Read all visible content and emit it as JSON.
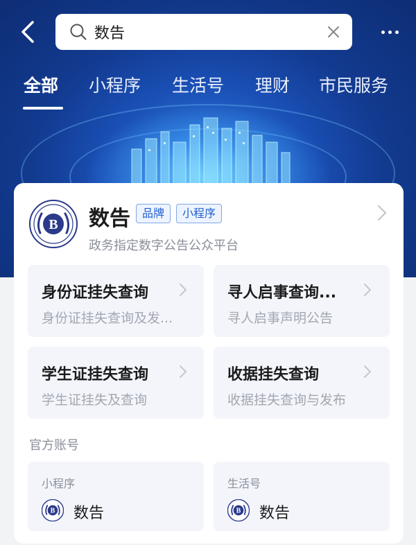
{
  "search": {
    "query": "数告"
  },
  "tabs": [
    "全部",
    "小程序",
    "生活号",
    "理财",
    "市民服务"
  ],
  "result": {
    "name": "数告",
    "tags": [
      "品牌",
      "小程序"
    ],
    "description": "政务指定数字公告公众平台",
    "logo_letter": "B"
  },
  "services": [
    {
      "title": "身份证挂失查询",
      "subtitle": "身份证挂失查询及发..."
    },
    {
      "title": "寻人启事查询...",
      "subtitle": "寻人启事声明公告"
    },
    {
      "title": "学生证挂失查询",
      "subtitle": "学生证挂失及查询"
    },
    {
      "title": "收据挂失查询",
      "subtitle": "收据挂失查询与发布"
    }
  ],
  "official": {
    "label": "官方账号",
    "accounts": [
      {
        "type": "小程序",
        "name": "数告"
      },
      {
        "type": "生活号",
        "name": "数告"
      }
    ]
  },
  "colors": {
    "accent": "#1f5fcf",
    "hero": "#123a8f"
  },
  "icons": [
    "back-arrow-icon",
    "search-icon",
    "clear-icon",
    "more-icon",
    "chevron-right-icon"
  ]
}
